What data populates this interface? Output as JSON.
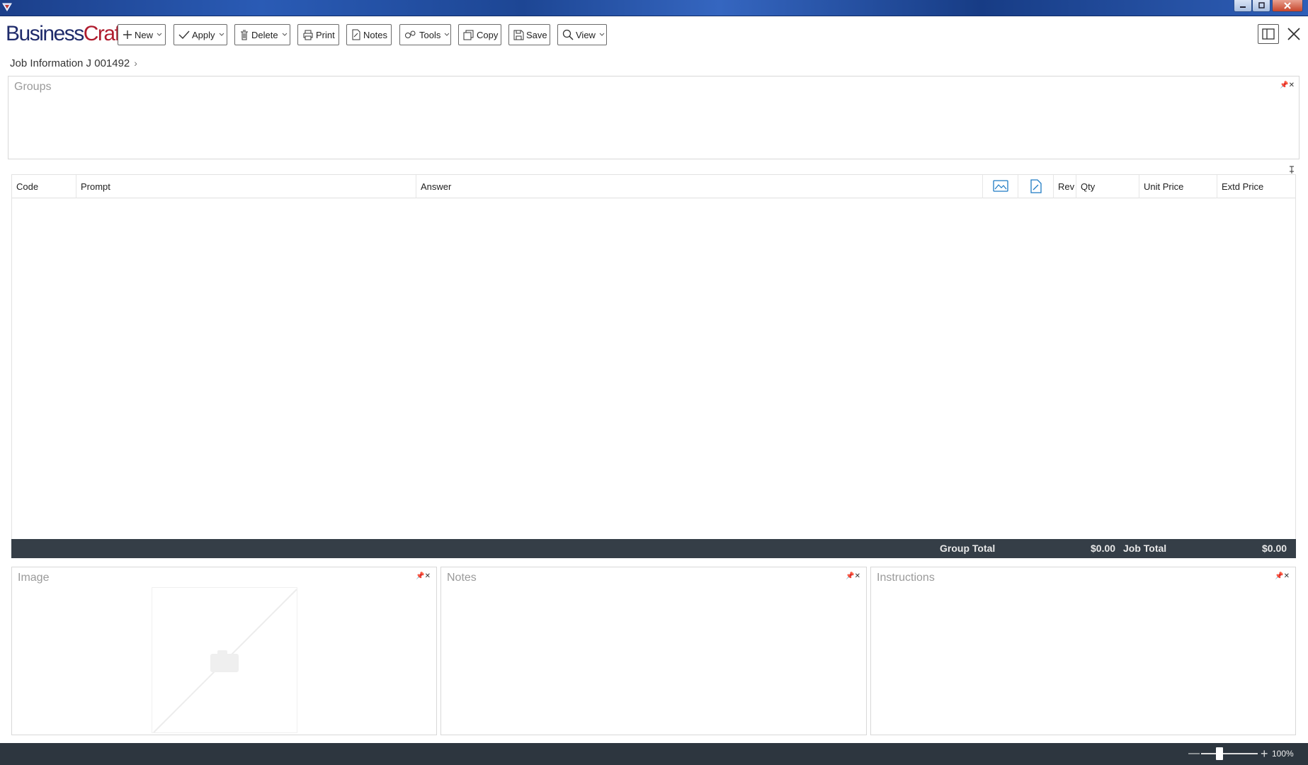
{
  "app": {
    "logo_part1": "Business",
    "logo_part2": "Craft"
  },
  "toolbar": {
    "new": "New",
    "apply": "Apply",
    "delete": "Delete",
    "print": "Print",
    "notes": "Notes",
    "tools": "Tools",
    "copy": "Copy",
    "save": "Save",
    "view": "View"
  },
  "breadcrumb": {
    "label": "Job Information J 001492",
    "chevron": "›"
  },
  "groups": {
    "title": "Groups",
    "pin": "📌✕"
  },
  "grid": {
    "columns": {
      "code": "Code",
      "prompt": "Prompt",
      "answer": "Answer",
      "image_icon": "image-icon",
      "note_icon": "note-icon",
      "rev": "Rev",
      "qty": "Qty",
      "unit_price": "Unit Price",
      "extd_price": "Extd Price"
    },
    "rows": [],
    "totals": {
      "group_label": "Group Total",
      "group_value": "$0.00",
      "job_label": "Job Total",
      "job_value": "$0.00"
    }
  },
  "panels": {
    "image": "Image",
    "notes": "Notes",
    "instructions": "Instructions"
  },
  "status": {
    "zoom": "100%",
    "zoom_minus": "—",
    "zoom_plus": "+"
  },
  "colors": {
    "brand_dark": "#1f2b6b",
    "brand_red": "#b01c2e",
    "totals_bar": "#353e47",
    "status_bar": "#2d363f",
    "icon_blue": "#1e7bc4"
  }
}
